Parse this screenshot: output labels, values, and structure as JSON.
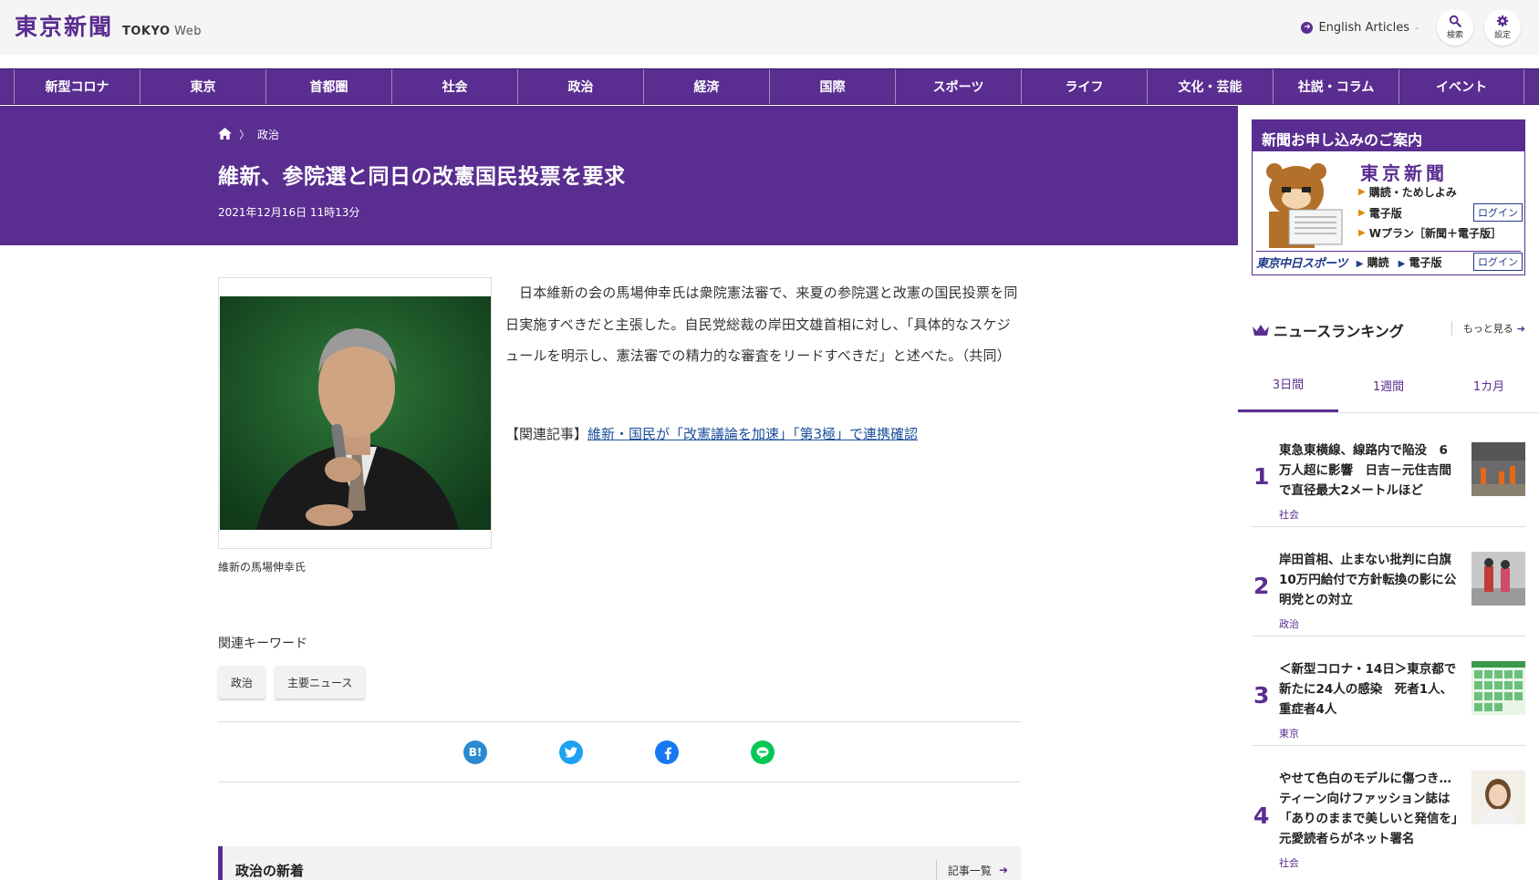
{
  "header": {
    "logo_kanji": "東京新聞",
    "logo_en_bold": "TOKYO",
    "logo_en_light": "Web",
    "english_link": "English Articles",
    "search_label": "検索",
    "settings_label": "設定"
  },
  "nav": {
    "items": [
      "新型コロナ",
      "東京",
      "首都圏",
      "社会",
      "政治",
      "経済",
      "国際",
      "スポーツ",
      "ライフ",
      "文化・芸能",
      "社説・コラム",
      "イベント"
    ]
  },
  "article": {
    "breadcrumb_category": "政治",
    "title": "維新、参院選と同日の改憲国民投票を要求",
    "date": "2021年12月16日 11時13分",
    "caption": "維新の馬場伸幸氏",
    "body": "日本維新の会の馬場伸幸氏は衆院憲法審で、来夏の参院選と改憲の国民投票を同日実施すべきだと主張した。自民党総裁の岸田文雄首相に対し、「具体的なスケジュールを明示し、憲法審での精力的な審査をリードすべきだ」と述べた。（共同）",
    "related_prefix": "【関連記事】",
    "related_link": "維新・国民が「改憲議論を加速」「第3極」で連携確認",
    "keywords_title": "関連キーワード",
    "keywords": [
      "政治",
      "主要ニュース"
    ]
  },
  "share": {
    "hatena_label": "B!"
  },
  "section": {
    "title": "政治の新着",
    "more": "記事一覧"
  },
  "ad": {
    "headline": "新聞お申し込みのご案内",
    "logo": "東京新聞",
    "line1": "購読・ためしよみ",
    "line2": "電子版",
    "line3": "Wプラン［新聞＋電子版］",
    "login": "ログイン",
    "sports_logo": "東京中日スポーツ",
    "sports_subscribe": "購読",
    "sports_digital": "電子版"
  },
  "ranking": {
    "title": "ニュースランキング",
    "more": "もっと見る",
    "tabs": [
      "3日間",
      "1週間",
      "1カ月"
    ],
    "items": [
      {
        "rank": "1",
        "title": "東急東横線、線路内で陥没　6万人超に影響　日吉－元住吉間で直径最大2メートルほど",
        "category": "社会"
      },
      {
        "rank": "2",
        "title": "岸田首相、止まない批判に白旗　10万円給付で方針転換の影に公明党との対立",
        "category": "政治"
      },
      {
        "rank": "3",
        "title": "＜新型コロナ・14日＞東京都で新たに24人の感染　死者1人、重症者4人",
        "category": "東京"
      },
      {
        "rank": "4",
        "title": "やせて色白のモデルに傷つき…ティーン向けファッション誌は「ありのままで美しいと発信を」元愛読者らがネット署名",
        "category": "社会"
      }
    ]
  },
  "colors": {
    "brand_purple": "#5a2d90",
    "twitter": "#1da1f2",
    "facebook": "#1877f2",
    "line": "#06c755",
    "hatena": "#2b8ad1"
  }
}
